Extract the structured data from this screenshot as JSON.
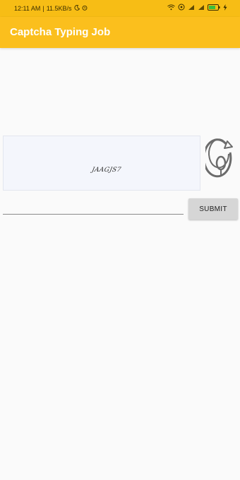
{
  "status_bar": {
    "time": "12:11 AM",
    "speed": "11.5KB/s",
    "icons_left": [
      "moon-icon",
      "alarm-icon"
    ],
    "icons_right": [
      "wifi-icon",
      "hotspot-icon",
      "signal-icon",
      "signal-icon",
      "battery-icon",
      "charging-icon"
    ]
  },
  "app_bar": {
    "title": "Captcha Typing Job",
    "background": "#fbbf1d"
  },
  "captcha": {
    "text": "JAAGJS7",
    "background": "#f4f6fc"
  },
  "refresh": {
    "icon": "refresh-icon"
  },
  "answer_input": {
    "value": "",
    "placeholder": ""
  },
  "submit": {
    "label": "SUBMIT"
  }
}
